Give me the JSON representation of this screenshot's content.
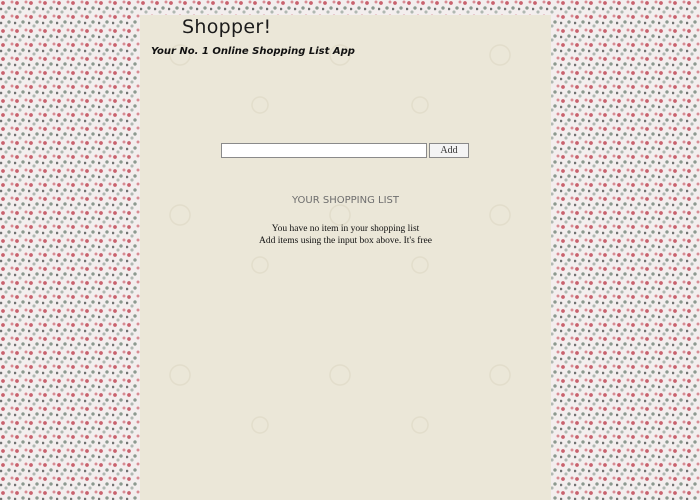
{
  "app": {
    "title": "Shopper!",
    "tagline": "Your No. 1 Online Shopping List App"
  },
  "add_form": {
    "input_value": "",
    "input_placeholder": "",
    "add_label": "Add"
  },
  "list": {
    "heading": "YOUR SHOPPING LIST",
    "empty_line_1": "You have no item in your shopping list",
    "empty_line_2": "Add items using the input box above. It's free"
  },
  "colors": {
    "panel_bg": "#ebe7d8",
    "heading_text": "#6e6e6e"
  }
}
